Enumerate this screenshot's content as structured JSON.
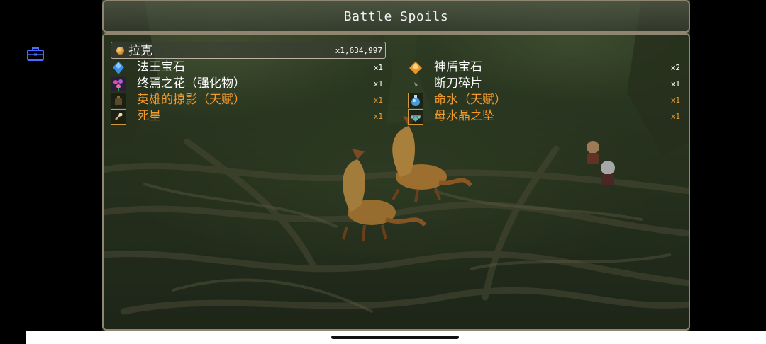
{
  "title": "Battle Spoils",
  "money": {
    "label": "拉克",
    "amount": "x1,634,997",
    "icon": "coin-icon"
  },
  "items_left": [
    {
      "name": "法王宝石",
      "qty": "x1",
      "icon": "blue-gem-icon",
      "talent": false
    },
    {
      "name": "终焉之花（强化物）",
      "qty": "x1",
      "icon": "flower-icon",
      "talent": false
    },
    {
      "name": "英雄的掠影（天赋）",
      "qty": "x1",
      "icon": "bottle-icon",
      "talent": true
    },
    {
      "name": "死星",
      "qty": "x1",
      "icon": "star-icon",
      "talent": true
    }
  ],
  "items_right": [
    {
      "name": "神盾宝石",
      "qty": "x2",
      "icon": "orange-gem-icon",
      "talent": false
    },
    {
      "name": "断刀碎片",
      "qty": "x1",
      "icon": "blade-shard-icon",
      "talent": false
    },
    {
      "name": "命水（天赋）",
      "qty": "x1",
      "icon": "water-flask-icon",
      "talent": true
    },
    {
      "name": "母水晶之坠",
      "qty": "x1",
      "icon": "crystal-pendant-icon",
      "talent": true
    }
  ],
  "colors": {
    "talent_text": "#f29a2c",
    "frame_border": "#8f8672",
    "sidebar_icon": "#4a6cff"
  }
}
